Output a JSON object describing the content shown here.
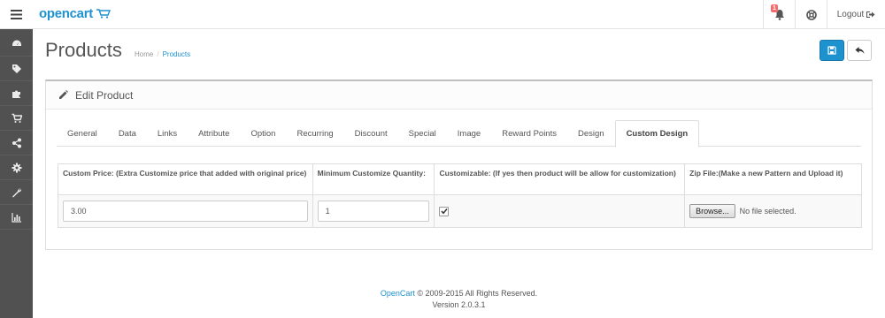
{
  "header": {
    "brand": "opencart",
    "alert_count": "1",
    "logout_label": "Logout"
  },
  "sidebar": {
    "items": [
      {
        "icon": "dashboard-icon"
      },
      {
        "icon": "tags-icon"
      },
      {
        "icon": "puzzle-icon"
      },
      {
        "icon": "cart-icon"
      },
      {
        "icon": "share-icon"
      },
      {
        "icon": "gear-icon"
      },
      {
        "icon": "wrench-icon"
      },
      {
        "icon": "bar-chart-icon"
      }
    ]
  },
  "page": {
    "title": "Products",
    "breadcrumb": [
      "Home",
      "Products"
    ]
  },
  "panel": {
    "heading": "Edit Product",
    "tabs": [
      "General",
      "Data",
      "Links",
      "Attribute",
      "Option",
      "Recurring",
      "Discount",
      "Special",
      "Image",
      "Reward Points",
      "Design",
      "Custom Design"
    ],
    "active_tab": "Custom Design"
  },
  "custom_design": {
    "columns": [
      "Custom Price: (Extra Customize price that added with original price)",
      "Minimum Customize Quantity:",
      "Customizable: (If yes then product will be allow for customization)",
      "Zip File:(Make a new Pattern and Upload it)"
    ],
    "custom_price": "3.00",
    "min_quantity": "1",
    "customizable_checked": true,
    "browse_label": "Browse...",
    "file_status": "No file selected."
  },
  "footer": {
    "link": "OpenCart",
    "copyright": "© 2009-2015 All Rights Reserved.",
    "version": "Version 2.0.3.1"
  },
  "colors": {
    "accent": "#1e91cf",
    "sidebar": "#515151",
    "badge": "#f56b6b"
  }
}
